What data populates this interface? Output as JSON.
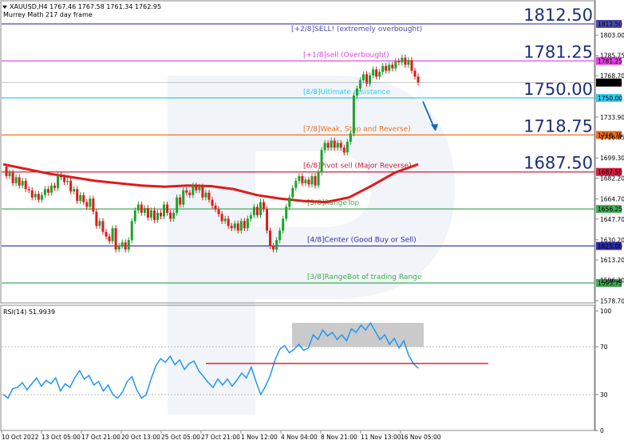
{
  "header": {
    "symbol_line": "XAUUSD,H4  1767.46 1767.58 1761.34 1762.95",
    "indicator_line": "Murrey Math 217 day frame",
    "symbol_icon": "triangle-down-icon"
  },
  "rsi_label": "RSI(14) 51.9939",
  "watermark_icon": "brand-watermark-icon",
  "colors": {
    "bull": "#1aa32a",
    "bear": "#e01a1a",
    "ma": "#e01a1a",
    "rsi": "#2196f3",
    "rsi_resistance": "#d00000",
    "arrow": "#1565c0",
    "big_label": "#1c2f78"
  },
  "chart_data": [
    {
      "type": "candlestick",
      "title": "XAUUSD,H4",
      "timeframe": "H4",
      "ohlc_last": {
        "open": 1767.46,
        "high": 1767.58,
        "low": 1761.34,
        "close": 1762.95
      },
      "ylim": [
        1572,
        1826
      ],
      "y_ticks": [
        1803.0,
        1785.75,
        1768.7,
        1733.9,
        1716.85,
        1699.3,
        1682.2,
        1664.7,
        1647.7,
        1630.2,
        1613.2,
        1596.2,
        1578.7
      ],
      "x_ticks": [
        "10 Oct 2022",
        "13 Oct 05:00",
        "17 Oct 21:00",
        "20 Oct 13:00",
        "25 Oct 05:00",
        "27 Oct 21:00",
        "1 Nov 12:00",
        "4 Nov 04:00",
        "8 Nov 21:00",
        "11 Nov 13:00",
        "16 Nov 05:00"
      ],
      "price_series": [
        1692,
        1684,
        1687,
        1678,
        1683,
        1676,
        1680,
        1673,
        1672,
        1666,
        1669,
        1664,
        1668,
        1673,
        1670,
        1676,
        1674,
        1685,
        1683,
        1679,
        1680,
        1671,
        1673,
        1663,
        1668,
        1662,
        1658,
        1665,
        1654,
        1642,
        1646,
        1637,
        1633,
        1629,
        1640,
        1622,
        1625,
        1628,
        1622,
        1630,
        1646,
        1655,
        1660,
        1653,
        1657,
        1649,
        1655,
        1647,
        1653,
        1650,
        1660,
        1653,
        1648,
        1653,
        1666,
        1660,
        1672,
        1670,
        1668,
        1676,
        1672,
        1675,
        1666,
        1670,
        1664,
        1659,
        1656,
        1652,
        1646,
        1648,
        1642,
        1640,
        1644,
        1638,
        1646,
        1640,
        1648,
        1651,
        1658,
        1651,
        1662,
        1656,
        1638,
        1625,
        1622,
        1630,
        1638,
        1648,
        1658,
        1666,
        1674,
        1680,
        1684,
        1678,
        1681,
        1677,
        1684,
        1676,
        1687,
        1706,
        1712,
        1708,
        1714,
        1708,
        1712,
        1708,
        1704,
        1713,
        1720,
        1752,
        1758,
        1765,
        1770,
        1762,
        1769,
        1774,
        1768,
        1772,
        1777,
        1773,
        1778,
        1775,
        1781,
        1780,
        1784,
        1778,
        1782,
        1773,
        1768,
        1763
      ],
      "moving_average": {
        "name": "Murrey Math 217 day frame",
        "values": [
          1694,
          1690,
          1686,
          1683,
          1680,
          1678,
          1676,
          1675,
          1676,
          1675.5,
          1673,
          1668,
          1665,
          1663,
          1662,
          1666,
          1676,
          1687,
          1694
        ]
      },
      "murrey_levels": [
        {
          "value": 1812.5,
          "text": "[+2/8]SELL! (extremely overbought)",
          "color": "#4a4aa8",
          "big": "1812.50",
          "tag": "1812.50"
        },
        {
          "value": 1781.25,
          "text": "[+1/8]sell (Overbought)",
          "color": "#e040e0",
          "big": "1781.25",
          "tag": "1781.25"
        },
        {
          "value": 1750.0,
          "text": "[8/8]Ultimate resistance",
          "color": "#33ccee",
          "big": "1750.00",
          "tag": "1750.00"
        },
        {
          "value": 1718.75,
          "text": "[7/8]Weak, Stop and Reverse)",
          "color": "#f07020",
          "big": "1718.75",
          "tag": "1718.75"
        },
        {
          "value": 1687.5,
          "text": "[6/8]Pivot sell (Major Reverse)",
          "color": "#d02040",
          "big": "1687.50",
          "tag": "1687.50"
        },
        {
          "value": 1656.25,
          "text": "[5/8]RangeTop",
          "color": "#44aa55",
          "big": "",
          "tag": "1656.25"
        },
        {
          "value": 1625.0,
          "text": "[4/8]Center (Good Buy or Sell)",
          "color": "#2b2baa",
          "big": "",
          "tag": "1625.00"
        },
        {
          "value": 1593.75,
          "text": "[3/8]RangeBot of trading Range",
          "color": "#44aa55",
          "big": "",
          "tag": "1593.75"
        }
      ],
      "last_price": 1762.95,
      "forecast": {
        "from": 1747,
        "to": 1722,
        "direction": "down"
      }
    },
    {
      "type": "line",
      "title": "RSI(14) 51.9939",
      "ylim": [
        0,
        100
      ],
      "y_ticks": [
        100,
        70,
        30,
        0
      ],
      "series": [
        {
          "name": "RSI(14)",
          "values": [
            30,
            27,
            35,
            36,
            40,
            34,
            39,
            44,
            37,
            42,
            39,
            44,
            33,
            39,
            36,
            44,
            50,
            43,
            46,
            38,
            41,
            33,
            38,
            30,
            27,
            32,
            41,
            45,
            34,
            27,
            30,
            43,
            54,
            60,
            57,
            62,
            55,
            59,
            51,
            56,
            58,
            50,
            45,
            40,
            36,
            43,
            38,
            43,
            37,
            42,
            48,
            44,
            53,
            41,
            30,
            37,
            46,
            59,
            68,
            71,
            65,
            68,
            72,
            67,
            69,
            80,
            76,
            84,
            79,
            82,
            76,
            80,
            75,
            85,
            82,
            88,
            84,
            90,
            83,
            76,
            80,
            72,
            77,
            69,
            75,
            63,
            56,
            51.99
          ]
        }
      ],
      "resistance_level": 56,
      "overbought_zone": [
        70,
        90
      ]
    }
  ]
}
